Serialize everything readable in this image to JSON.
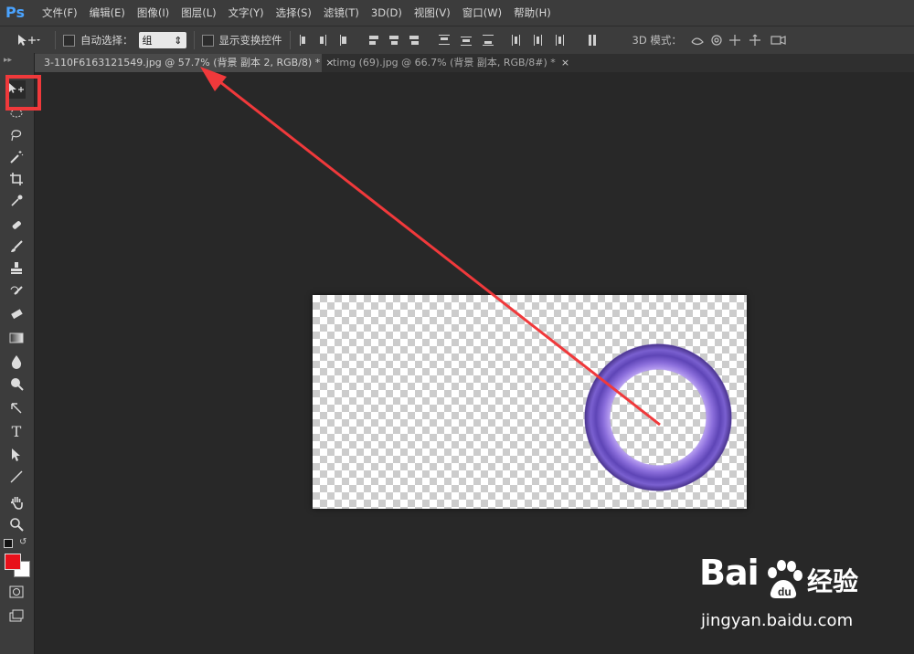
{
  "app": {
    "logo": "Ps",
    "menu": [
      "文件(F)",
      "编辑(E)",
      "图像(I)",
      "图层(L)",
      "文字(Y)",
      "选择(S)",
      "滤镜(T)",
      "3D(D)",
      "视图(V)",
      "窗口(W)",
      "帮助(H)"
    ]
  },
  "options": {
    "auto_select_label": "自动选择：",
    "auto_select_value": "组",
    "show_transform_label": "显示变换控件",
    "mode_3d_label": "3D 模式："
  },
  "tabs": [
    {
      "label": "3-110F6163121549.jpg @ 57.7% (背景 副本 2, RGB/8) *",
      "close": "×"
    },
    {
      "label": "timg (69).jpg @ 66.7% (背景 副本, RGB/8#) *",
      "close": "×"
    }
  ],
  "colors": {
    "foreground": "#e8101a",
    "background": "#ffffff",
    "annotation": "#f0393b",
    "ring_main": "#6c52c8"
  },
  "watermark": {
    "logo": "Bai",
    "suffix": "经验",
    "url": "jingyan.baidu.com"
  },
  "icons": [
    "move-tool-icon",
    "marquee-icon",
    "lasso-icon",
    "magic-wand-icon",
    "crop-icon",
    "eyedropper-icon",
    "healing-brush-icon",
    "brush-icon",
    "clone-stamp-icon",
    "history-brush-icon",
    "eraser-icon",
    "gradient-icon",
    "blur-icon",
    "dodge-icon",
    "pen-icon",
    "type-icon",
    "path-select-icon",
    "line-icon",
    "hand-icon",
    "zoom-icon"
  ]
}
